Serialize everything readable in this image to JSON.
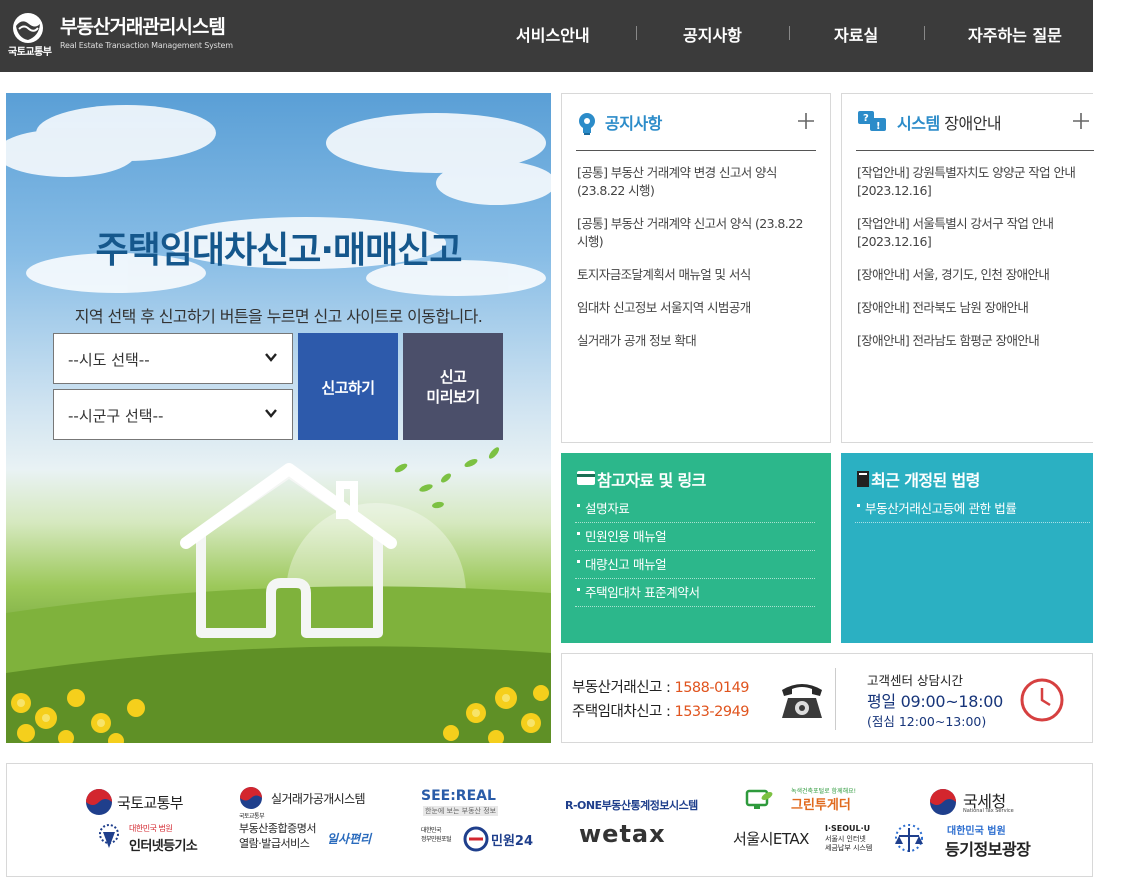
{
  "header": {
    "ministry": "국토교통부",
    "title": "부동산거래관리시스템",
    "subtitle": "Real Estate Transaction Management System",
    "nav": [
      "서비스안내",
      "공지사항",
      "자료실",
      "자주하는 질문"
    ]
  },
  "hero": {
    "title": "주택임대차신고·매매신고",
    "description": "지역 선택 후 신고하기 버튼을 누르면 신고 사이트로 이동합니다.",
    "sido_select": "--시도 선택--",
    "sigungu_select": "--시군구 선택--",
    "report_button": "신고하기",
    "preview_button_line1": "신고",
    "preview_button_line2": "미리보기"
  },
  "notice": {
    "title": "공지사항",
    "items": [
      "[공통] 부동산 거래계약 변경 신고서 양식 (23.8.22 시행)",
      "[공통] 부동산 거래계약 신고서 양식 (23.8.22 시행)",
      "토지자금조달계획서 매뉴얼 및 서식",
      "임대차 신고정보 서울지역 시범공개",
      "실거래가 공개 정보 확대"
    ]
  },
  "outage": {
    "title_accent": "시스템",
    "title_rest": " 장애안내",
    "items": [
      "[작업안내] 강원특별자치도 양양군 작업 안내 [2023.12.16]",
      "[작업안내] 서울특별시 강서구 작업 안내 [2023.12.16]",
      "[장애안내] 서울, 경기도, 인천 장애안내",
      "[장애안내] 전라북도 남원 장애안내",
      "[장애안내] 전라남도 함평군 장애안내"
    ]
  },
  "reference": {
    "title": "참고자료 및 링크",
    "items": [
      "설명자료",
      "민원인용 매뉴얼",
      "대량신고 매뉴얼",
      "주택임대차 표준계약서"
    ]
  },
  "laws": {
    "title": "최근 개정된 법령",
    "items": [
      "부동산거래신고등에 관한 법률"
    ]
  },
  "contact": {
    "line1_label": "부동산거래신고 : ",
    "line1_number": "1588-0149",
    "line2_label": "주택임대차신고 : ",
    "line2_number": "1533-2949",
    "hours_title": "고객센터 상담시간",
    "hours_main": "평일 09:00~18:00",
    "hours_lunch": "(점심 12:00~13:00)"
  },
  "banners": {
    "molit": "국토교통부",
    "molit_small": "국토교통부",
    "court_small": "대한민국 법원",
    "internet_registry": "인터넷등기소",
    "rtms": "실거래가공개시스템",
    "issuance_line1": "부동산종합증명서",
    "issuance_line2": "열람·발급서비스",
    "ilsa": "일사편리",
    "seereal": "SEE:REAL",
    "seereal_sub": "한눈에 보는 부동산 정보",
    "minwon_small1": "대한민국",
    "minwon_small2": "정부민원포털",
    "minwon24": "민원24",
    "rone": "R-ONE부동산통계정보시스템",
    "wetax": "wetax",
    "greenbiz_small": "녹색건축포털로 함께해요!",
    "greenbiz": "그린투게더",
    "seoul_etax": "서울시ETAX",
    "iseoulu": "I·SEOUL·U",
    "seoul_etax_sub1": "서울시 인터넷",
    "seoul_etax_sub2": "세금납부 시스템",
    "nts": "국세청",
    "nts_small": "National Tax Service",
    "court_title": "대한민국 법원",
    "registry_plaza": "등기정보광장"
  },
  "colors": {
    "header_bg": "#3b3b3b",
    "report_button": "#2d5aab",
    "preview_button": "#4b4f6a",
    "reference_panel": "#2cb78b",
    "laws_panel": "#2bb0c2",
    "accent_blue": "#2c8cc9",
    "phone_orange": "#e0541e"
  }
}
